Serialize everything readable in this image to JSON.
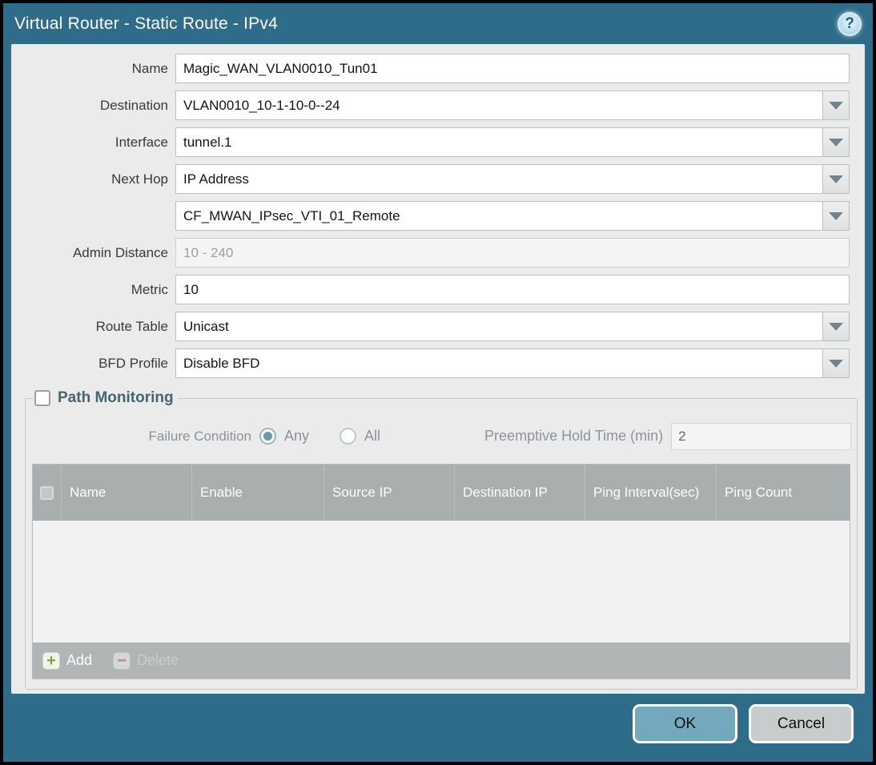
{
  "titlebar": {
    "title": "Virtual Router - Static Route - IPv4",
    "help_icon": "?"
  },
  "form": {
    "name": {
      "label": "Name",
      "value": "Magic_WAN_VLAN0010_Tun01"
    },
    "destination": {
      "label": "Destination",
      "value": "VLAN0010_10-1-10-0--24"
    },
    "interface": {
      "label": "Interface",
      "value": "tunnel.1"
    },
    "next_hop": {
      "label": "Next Hop",
      "value": "IP Address"
    },
    "next_hop_address": {
      "value": "CF_MWAN_IPsec_VTI_01_Remote"
    },
    "admin_distance": {
      "label": "Admin Distance",
      "placeholder": "10 - 240",
      "value": ""
    },
    "metric": {
      "label": "Metric",
      "value": "10"
    },
    "route_table": {
      "label": "Route Table",
      "value": "Unicast"
    },
    "bfd_profile": {
      "label": "BFD Profile",
      "value": "Disable BFD"
    }
  },
  "path_monitoring": {
    "title": "Path Monitoring",
    "enabled": false,
    "failure_condition": {
      "label": "Failure Condition",
      "options": [
        "Any",
        "All"
      ],
      "selected": "Any"
    },
    "preemptive_hold_time": {
      "label": "Preemptive Hold Time (min)",
      "value": "2"
    },
    "table": {
      "columns": [
        "Name",
        "Enable",
        "Source IP",
        "Destination IP",
        "Ping Interval(sec)",
        "Ping Count"
      ],
      "rows": []
    },
    "toolbar": {
      "add_label": "Add",
      "delete_label": "Delete"
    }
  },
  "footer": {
    "ok_label": "OK",
    "cancel_label": "Cancel"
  },
  "colors": {
    "titlebar_teal": "#2e6c8a",
    "panel_gray": "#ebebeb",
    "table_header_gray": "#a9aeae",
    "ok_button": "#74a9bd",
    "cancel_button": "#c8cccd",
    "radio_selected": "#669bac",
    "add_icon_green": "#7fa43a",
    "delete_icon_red": "#b26460"
  }
}
